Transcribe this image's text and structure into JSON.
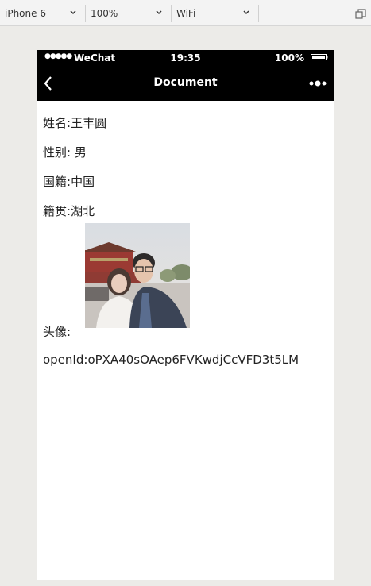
{
  "devtools": {
    "device": "iPhone 6",
    "zoom": "100%",
    "network": "WiFi"
  },
  "statusbar": {
    "signal": "●●●●●",
    "carrier": "WeChat",
    "time": "19:35",
    "battery": "100%"
  },
  "navbar": {
    "title": "Document"
  },
  "profile": {
    "name_label": "姓名:",
    "name_value": "王丰圆",
    "gender_label": "性别:",
    "gender_value": "男",
    "nationality_label": "国籍:",
    "nationality_value": "中国",
    "hometown_label": "籍贯:",
    "hometown_value": "湖北",
    "avatar_label": "头像:",
    "openid_label": "openId:",
    "openid_value": "oPXA40sOAep6FVKwdjCcVFD3t5LM"
  }
}
